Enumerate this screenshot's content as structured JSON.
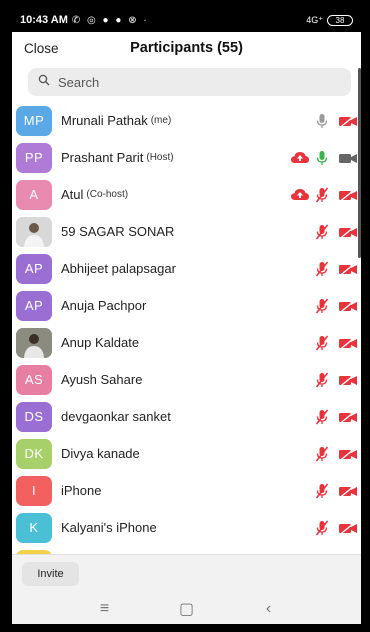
{
  "status": {
    "time": "10:43 AM",
    "glyphs": "✆ ◎ ● ● ⊗ ·",
    "signal": "4G⁺",
    "battery": "38"
  },
  "header": {
    "close_label": "Close",
    "title": "Participants (55)"
  },
  "search": {
    "placeholder": "Search"
  },
  "participants": [
    {
      "initials": "MP",
      "color": "#5aa9e6",
      "name": "Mrunali Pathak",
      "role": "(me)",
      "share": false,
      "mic": "off-gray",
      "cam": "off-red"
    },
    {
      "initials": "PP",
      "color": "#b07bd6",
      "name": "Prashant Parit",
      "role": "(Host)",
      "share": true,
      "mic": "on-green",
      "cam": "on-gray"
    },
    {
      "initials": "A",
      "color": "#e98bb0",
      "name": "Atul",
      "role": "(Co-host)",
      "share": true,
      "mic": "muted-red",
      "cam": "off-red"
    },
    {
      "initials": "",
      "color": "photo",
      "name": "59 SAGAR SONAR",
      "role": "",
      "share": false,
      "mic": "muted-red",
      "cam": "off-red"
    },
    {
      "initials": "AP",
      "color": "#9a6fd3",
      "name": "Abhijeet palapsagar",
      "role": "",
      "share": false,
      "mic": "muted-red",
      "cam": "off-red"
    },
    {
      "initials": "AP",
      "color": "#9a6fd3",
      "name": "Anuja Pachpor",
      "role": "",
      "share": false,
      "mic": "muted-red",
      "cam": "off-red"
    },
    {
      "initials": "",
      "color": "photo",
      "name": "Anup Kaldate",
      "role": "",
      "share": false,
      "mic": "muted-red",
      "cam": "off-red"
    },
    {
      "initials": "AS",
      "color": "#e77fa3",
      "name": "Ayush Sahare",
      "role": "",
      "share": false,
      "mic": "muted-red",
      "cam": "off-red"
    },
    {
      "initials": "DS",
      "color": "#9a6fd3",
      "name": "devgaonkar sanket",
      "role": "",
      "share": false,
      "mic": "muted-red",
      "cam": "off-red"
    },
    {
      "initials": "DK",
      "color": "#a7cf6a",
      "name": "Divya kanade",
      "role": "",
      "share": false,
      "mic": "muted-red",
      "cam": "off-red"
    },
    {
      "initials": "I",
      "color": "#f26060",
      "name": "iPhone",
      "role": "",
      "share": false,
      "mic": "muted-red",
      "cam": "off-red"
    },
    {
      "initials": "K",
      "color": "#4bbfd6",
      "name": "Kalyani's iPhone",
      "role": "",
      "share": false,
      "mic": "muted-red",
      "cam": "off-red"
    },
    {
      "initials": "",
      "color": "#f3d24a",
      "name": "",
      "role": "",
      "share": false,
      "mic": "none",
      "cam": "none"
    }
  ],
  "bottom": {
    "invite_label": "Invite"
  },
  "navbar": {
    "recents": "≡",
    "home": "▢",
    "back": "‹"
  },
  "colors": {
    "red": "#e8323c",
    "green": "#3bb34a",
    "gray": "#9a9a9a"
  }
}
